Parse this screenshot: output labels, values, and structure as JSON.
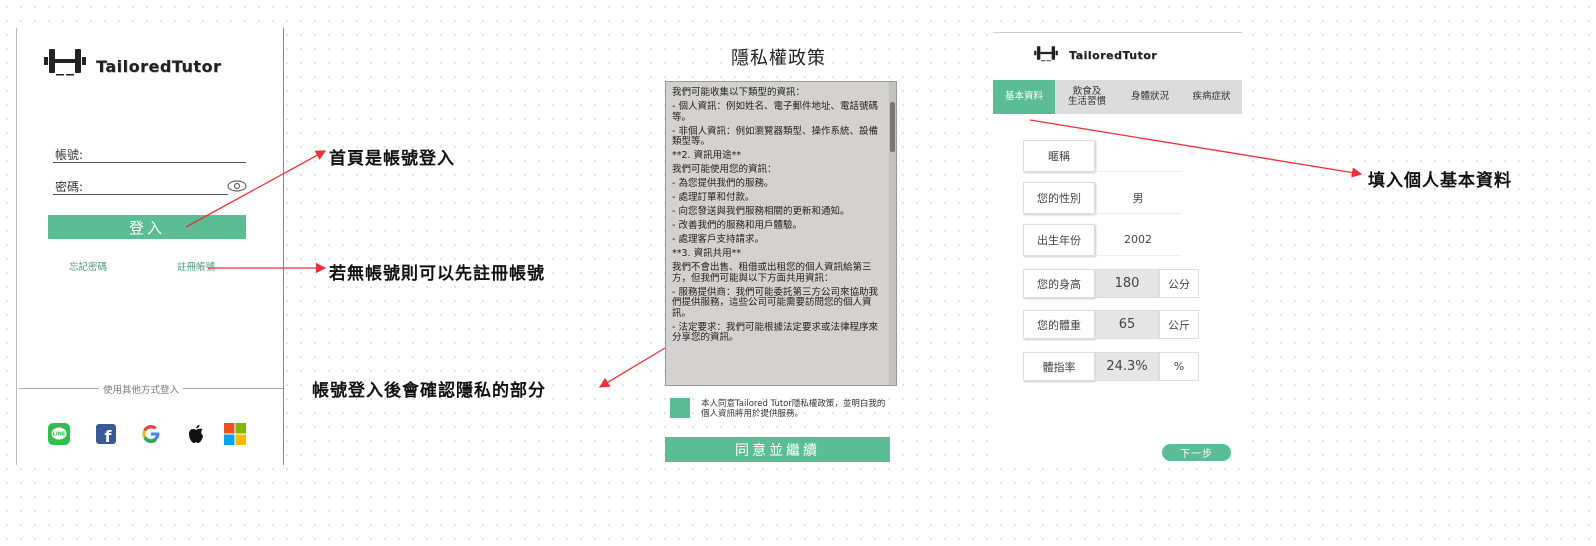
{
  "login": {
    "brand": "TailoredTutor",
    "account_label": "帳號:",
    "password_label": "密碼:",
    "login_button": "登入",
    "forgot_password": "忘記密碼",
    "register": "註冊帳號",
    "other_login": "使用其他方式登入",
    "social_icons": [
      "line-icon",
      "facebook-icon",
      "google-icon",
      "apple-icon",
      "windows-icon"
    ]
  },
  "annotations": {
    "a1": "首頁是帳號登入",
    "a2": "若無帳號則可以先註冊帳號",
    "a3": "帳號登入後會確認隱私的部分",
    "a4": "填入個人基本資料"
  },
  "policy": {
    "title": "隱私權政策",
    "paragraphs": [
      "我們可能收集以下類型的資訊：",
      "- 個人資訊：例如姓名、電子郵件地址、電話號碼等。",
      "- 非個人資訊：例如瀏覽器類型、操作系統、設備類型等。",
      "**2. 資訊用途**",
      "我們可能使用您的資訊：",
      "- 為您提供我們的服務。",
      "- 處理訂單和付款。",
      "- 向您發送與我們服務相關的更新和通知。",
      "- 改善我們的服務和用戶體驗。",
      "- 處理客戶支持請求。",
      "**3. 資訊共用**",
      "我們不會出售、租借或出租您的個人資訊給第三方，但我們可能與以下方面共用資訊：",
      "- 服務提供商：我們可能委託第三方公司來協助我們提供服務，這些公司可能需要訪問您的個人資訊。",
      "- 法定要求：我們可能根據法定要求或法律程序來分享您的資訊。"
    ],
    "agree_text": "本人同意Tailored Tutor隱私權政策，並明白我的個人資訊將用於提供服務。",
    "continue_button": "同意並繼續"
  },
  "profile": {
    "brand": "TailoredTutor",
    "tabs": [
      {
        "label": "基本資料",
        "active": true
      },
      {
        "label": "飲食及\n生活習慣",
        "active": false
      },
      {
        "label": "身體狀況",
        "active": false
      },
      {
        "label": "疾病症狀",
        "active": false
      }
    ],
    "fields": {
      "nickname": {
        "label": "暱稱",
        "value": ""
      },
      "gender": {
        "label": "您的性別",
        "value": "男"
      },
      "birth_year": {
        "label": "出生年份",
        "value": "2002"
      },
      "height": {
        "label": "您的身高",
        "value": "180",
        "unit": "公分"
      },
      "weight": {
        "label": "您的體重",
        "value": "65",
        "unit": "公斤"
      },
      "bmi": {
        "label": "體指率",
        "value": "24.3%",
        "unit": "%"
      }
    },
    "next_button": "下一步"
  },
  "colors": {
    "accent": "#5bbd94",
    "arrow": "#e8323c"
  }
}
